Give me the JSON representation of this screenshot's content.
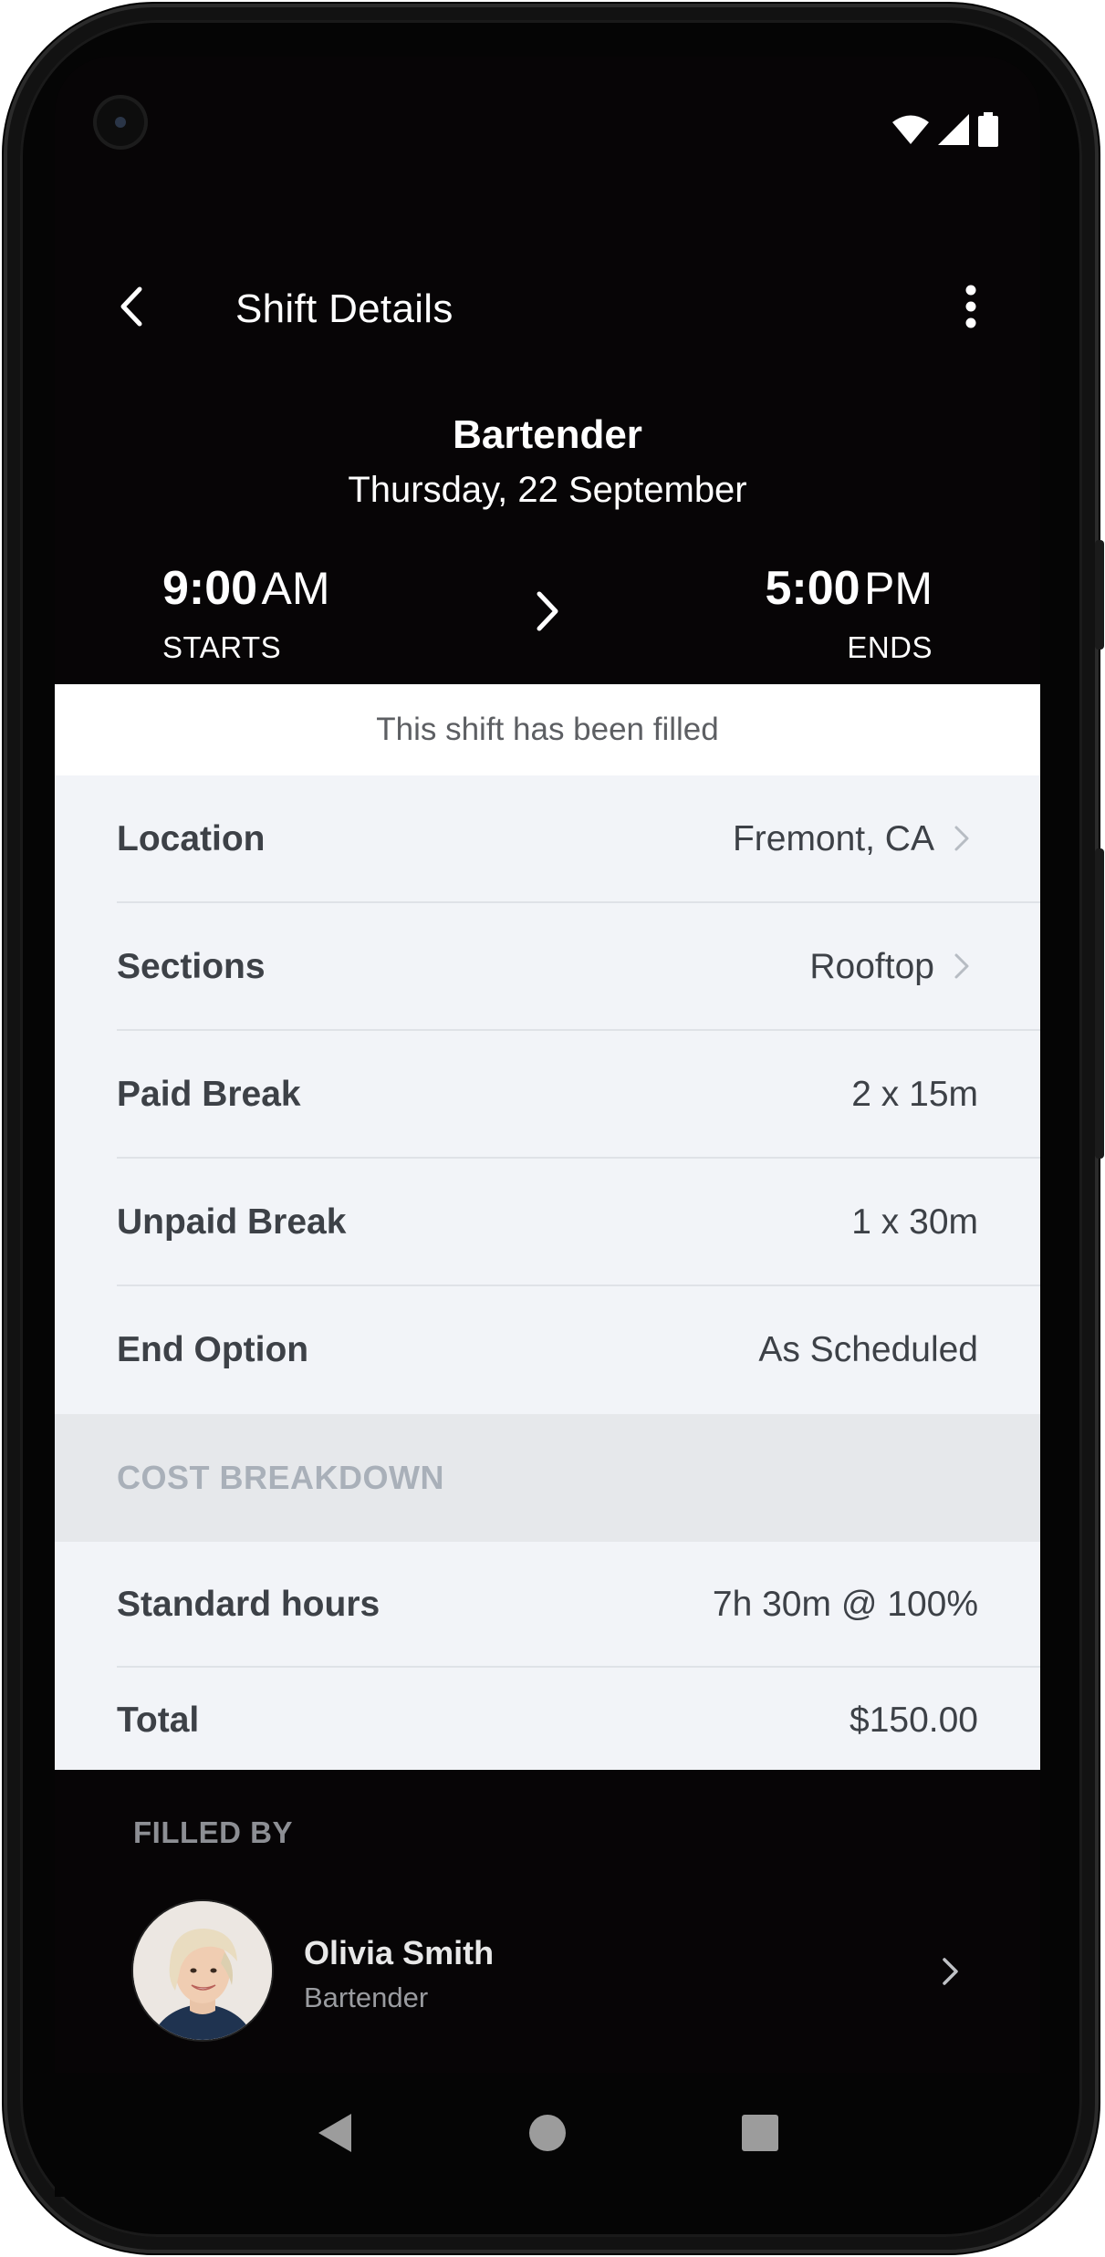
{
  "app": {
    "title": "Shift Details"
  },
  "shift": {
    "role": "Bartender",
    "date": "Thursday, 22 September",
    "start_time": "9:00",
    "start_suffix": "AM",
    "start_caption": "STARTS",
    "end_time": "5:00",
    "end_suffix": "PM",
    "end_caption": "ENDS",
    "status_banner": "This shift has been filled"
  },
  "details": {
    "rows": [
      {
        "label": "Location",
        "value": "Fremont, CA"
      },
      {
        "label": "Sections",
        "value": "Rooftop"
      },
      {
        "label": "Paid Break",
        "value": "2 x 15m"
      },
      {
        "label": "Unpaid Break",
        "value": "1 x 30m"
      },
      {
        "label": "End Option",
        "value": "As Scheduled"
      }
    ]
  },
  "cost": {
    "header": "COST BREAKDOWN",
    "rows": [
      {
        "label": "Standard hours",
        "value": "7h 30m @ 100%"
      },
      {
        "label": "Total",
        "value": "$150.00"
      }
    ]
  },
  "filled_by": {
    "header": "FILLED BY",
    "name": "Olivia Smith",
    "role": "Bartender"
  },
  "icons": {
    "back": "back-arrow-icon",
    "more": "more-vert-icon",
    "wifi": "wifi-icon",
    "signal": "signal-icon",
    "battery": "battery-icon",
    "chevron": "chevron-right-icon",
    "nav_back": "nav-back-icon",
    "nav_home": "nav-home-icon",
    "nav_recents": "nav-recents-icon"
  },
  "colors": {
    "background_dark": "#070506",
    "banner": "#ffffff",
    "detail_bg": "#f2f4f8",
    "section_header_bg": "#e6e8eb",
    "section_header_text": "#a9b0b9",
    "text_primary": "#3d4147"
  }
}
